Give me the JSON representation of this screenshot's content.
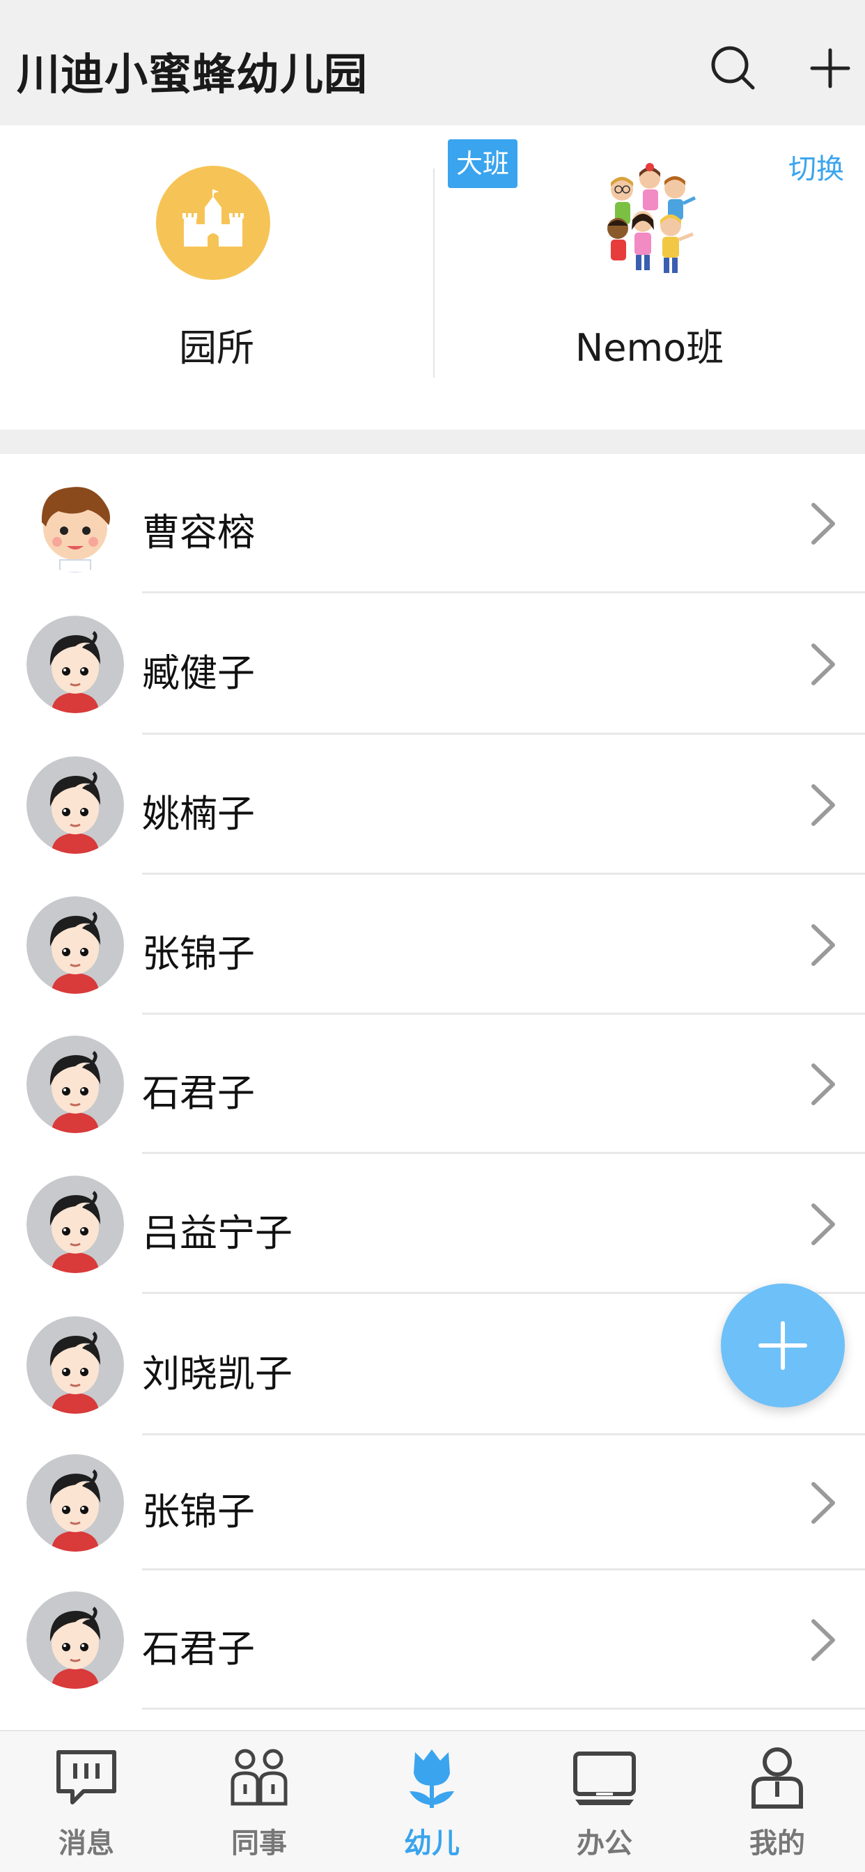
{
  "header": {
    "title": "川迪小蜜蜂幼儿园",
    "search_icon": "search-icon",
    "add_icon": "plus-icon"
  },
  "cards": {
    "yuansuo": {
      "label": "园所",
      "icon": "castle-icon",
      "icon_color": "#f6c456"
    },
    "class": {
      "badge": "大班",
      "switch_label": "切换",
      "label": "Nemo班",
      "icon": "kids-group-icon"
    }
  },
  "students": [
    {
      "name": "曹容榕",
      "avatar": "boy-avatar"
    },
    {
      "name": "臧健子",
      "avatar": "default-child-avatar"
    },
    {
      "name": "姚楠子",
      "avatar": "default-child-avatar"
    },
    {
      "name": "张锦子",
      "avatar": "default-child-avatar"
    },
    {
      "name": "石君子",
      "avatar": "default-child-avatar"
    },
    {
      "name": "吕益宁子",
      "avatar": "default-child-avatar"
    },
    {
      "name": "刘晓凯子",
      "avatar": "default-child-avatar"
    },
    {
      "name": "张锦子",
      "avatar": "default-child-avatar"
    },
    {
      "name": "石君子",
      "avatar": "default-child-avatar"
    }
  ],
  "fab": {
    "icon": "plus-icon",
    "color": "#6ec0f8"
  },
  "bottom_nav": {
    "items": [
      {
        "label": "消息",
        "icon": "message-icon",
        "active": false
      },
      {
        "label": "同事",
        "icon": "colleagues-icon",
        "active": false
      },
      {
        "label": "幼儿",
        "icon": "tulip-icon",
        "active": true
      },
      {
        "label": "办公",
        "icon": "office-icon",
        "active": false
      },
      {
        "label": "我的",
        "icon": "profile-icon",
        "active": false
      }
    ]
  },
  "colors": {
    "accent": "#3aa4ee",
    "header_bg": "#f0f0f0"
  }
}
